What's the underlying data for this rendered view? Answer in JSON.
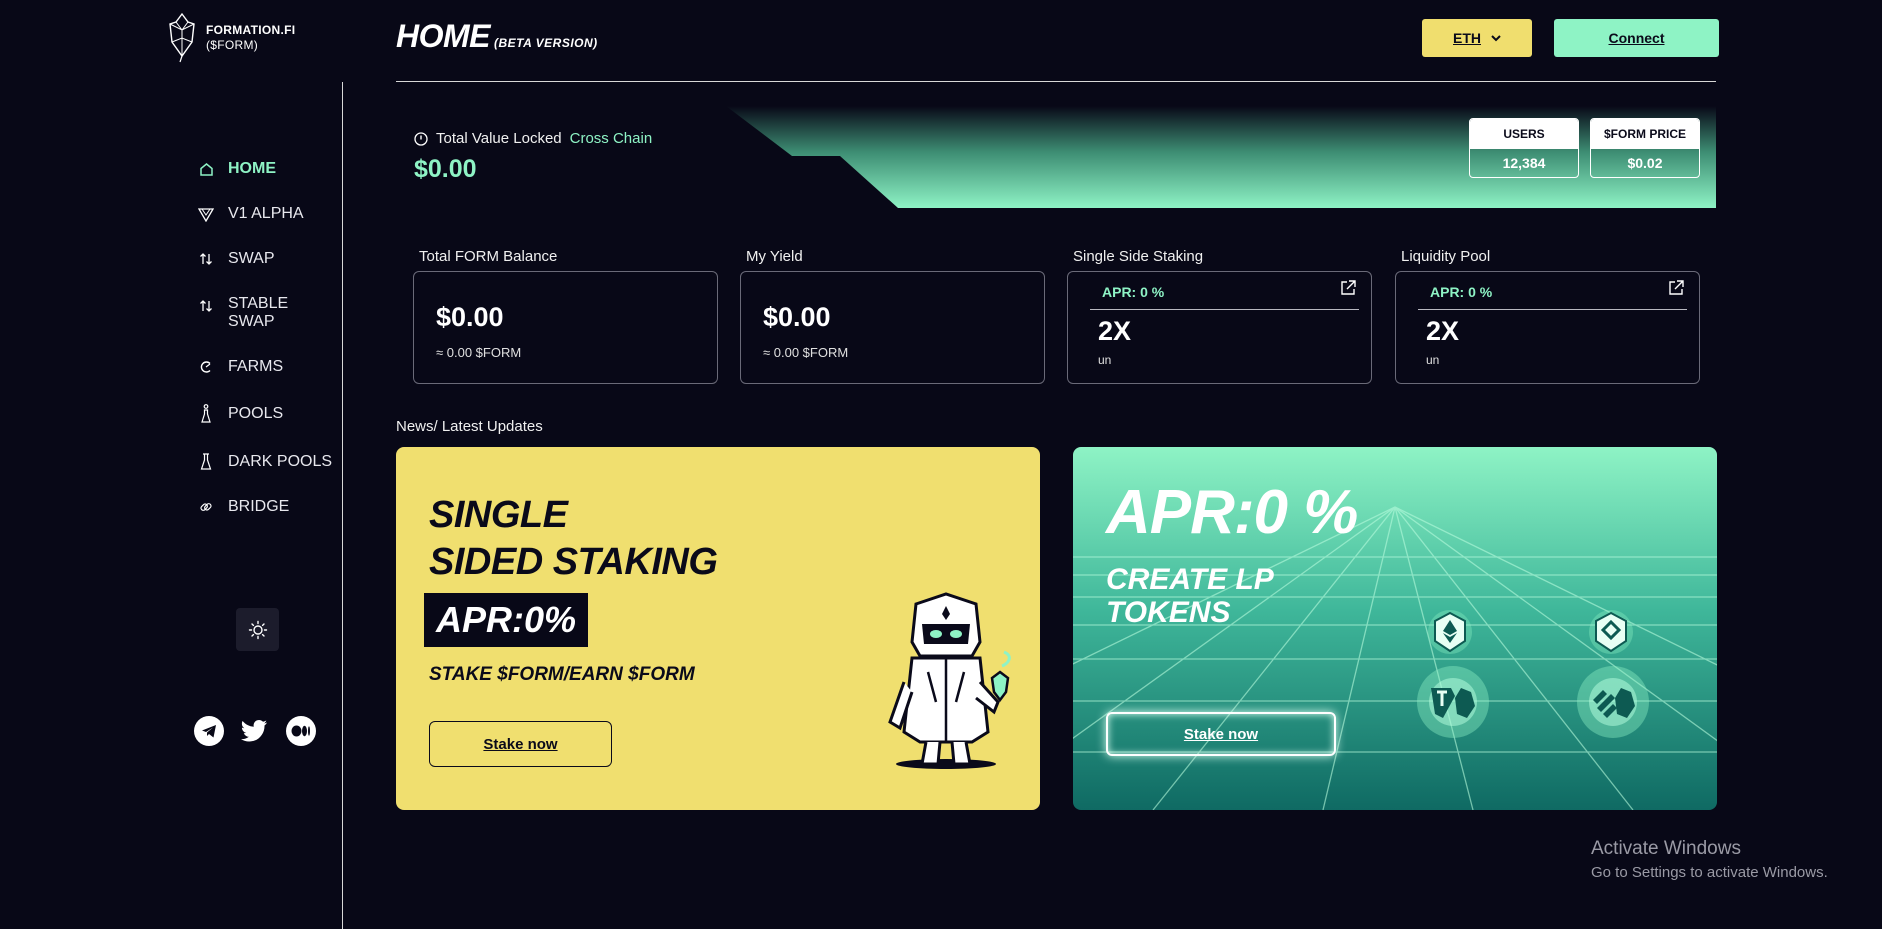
{
  "brand": {
    "name": "FORMATION.FI",
    "ticker": "($FORM)"
  },
  "sidebar": {
    "items": [
      {
        "label": "HOME",
        "icon": "home-icon",
        "active": true
      },
      {
        "label": "V1 ALPHA",
        "icon": "alpha-icon",
        "active": false
      },
      {
        "label": "SWAP",
        "icon": "swap-arrows-icon",
        "active": false
      },
      {
        "label": "STABLE SWAP",
        "icon": "swap-arrows-icon",
        "active": false
      },
      {
        "label": "FARMS",
        "icon": "farm-icon",
        "active": false
      },
      {
        "label": "POOLS",
        "icon": "pool-flask-icon",
        "active": false
      },
      {
        "label": "DARK POOLS",
        "icon": "flask-icon",
        "active": false
      },
      {
        "label": "BRIDGE",
        "icon": "bridge-link-icon",
        "active": false
      }
    ],
    "theme_toggle_icon": "sun-icon",
    "socials": [
      "telegram-icon",
      "twitter-icon",
      "medium-icon"
    ]
  },
  "header": {
    "title": "HOME",
    "subtitle": "(BETA VERSION)",
    "network_label": "ETH",
    "connect_label": "Connect"
  },
  "tvl": {
    "label": "Total Value Locked",
    "label_accent": "Cross Chain",
    "value": "$0.00",
    "stats": [
      {
        "label": "USERS",
        "value": "12,384"
      },
      {
        "label": "$FORM PRICE",
        "value": "$0.02"
      }
    ]
  },
  "cards": [
    {
      "title": "Total FORM Balance",
      "value": "$0.00",
      "sub": "≈ 0.00  $FORM"
    },
    {
      "title": "My Yield",
      "value": "$0.00",
      "sub": "≈ 0.00  $FORM"
    },
    {
      "title": "Single Side Staking",
      "apr": "APR: 0 %",
      "multiplier": "2X",
      "unit": "un"
    },
    {
      "title": "Liquidity Pool",
      "apr": "APR: 0 %",
      "multiplier": "2X",
      "unit": "un"
    }
  ],
  "news": {
    "title": "News/ Latest Updates",
    "single": {
      "heading_line1": "SINGLE",
      "heading_line2": "SIDED STAKING",
      "apr": "APR:0%",
      "subheading": "STAKE $FORM/EARN $FORM",
      "button": "Stake now"
    },
    "lp": {
      "apr": "APR:0 %",
      "heading_line1": "CREATE LP",
      "heading_line2": "TOKENS",
      "button": "Stake now"
    }
  },
  "watermark": {
    "line1": "Activate Windows",
    "line2": "Go to Settings to activate Windows."
  },
  "colors": {
    "background": "#080817",
    "accent_green": "#8ef3c5",
    "accent_yellow": "#f0de6e",
    "text": "#ffffff"
  }
}
